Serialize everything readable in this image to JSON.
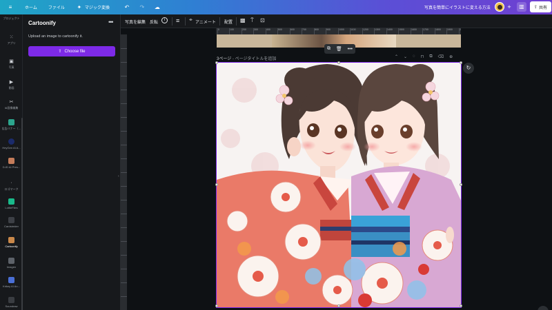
{
  "topbar": {
    "home_label": "ホーム",
    "file_label": "ファイル",
    "magic_label": "マジック変換",
    "doc_title": "写真を簡単にイラストに変える方法",
    "share_label": "共有"
  },
  "rail": {
    "items": [
      {
        "label": "プロジェクト",
        "icon": "folder-icon"
      },
      {
        "label": "アプリ",
        "icon": "apps-grid-icon"
      },
      {
        "label": "写真",
        "icon": "photo-icon"
      },
      {
        "label": "動画",
        "icon": "video-icon"
      },
      {
        "label": "AI画像編集",
        "icon": "magic-edit-icon"
      },
      {
        "label": "広告バナー（…",
        "icon": "banner-app-icon"
      },
      {
        "label": "HeyGen AI A...",
        "icon": "heygen-icon"
      },
      {
        "label": "D-ID AI Pres...",
        "icon": "did-icon"
      },
      {
        "label": "ロゴマーク",
        "icon": "logo-mark-icon"
      },
      {
        "label": "LottieFiles",
        "icon": "lottie-icon"
      },
      {
        "label": "Cardsbrider",
        "icon": "cards-icon"
      },
      {
        "label": "Cartoonify",
        "icon": "cartoonify-icon"
      },
      {
        "label": "Imagen",
        "icon": "imagen-icon"
      },
      {
        "label": "Krikey AI An...",
        "icon": "krikey-icon"
      },
      {
        "label": "Soundraw",
        "icon": "soundraw-icon"
      }
    ],
    "active": "Cartoonify"
  },
  "panel": {
    "title": "Cartoonify",
    "description": "Upload an image to cartoonify it.",
    "button_label": "Choose file"
  },
  "toolbar": {
    "edit_photo": "写真を編集",
    "flip": "反転",
    "animate": "アニメート",
    "position": "配置"
  },
  "ruler": {
    "ticks": [
      "0",
      "100",
      "200",
      "300",
      "400",
      "500",
      "600",
      "700",
      "800",
      "900",
      "1000",
      "1100",
      "1200",
      "1300",
      "1400",
      "1500",
      "1600",
      "1700",
      "1800",
      "1900",
      "2000"
    ]
  },
  "page": {
    "number_label": "3ページ",
    "title_placeholder": "ページタイトルを追加"
  },
  "colors": {
    "accent": "#7d2ae8",
    "topbar_start": "#1fa6c6",
    "topbar_end": "#6f3fd1"
  }
}
